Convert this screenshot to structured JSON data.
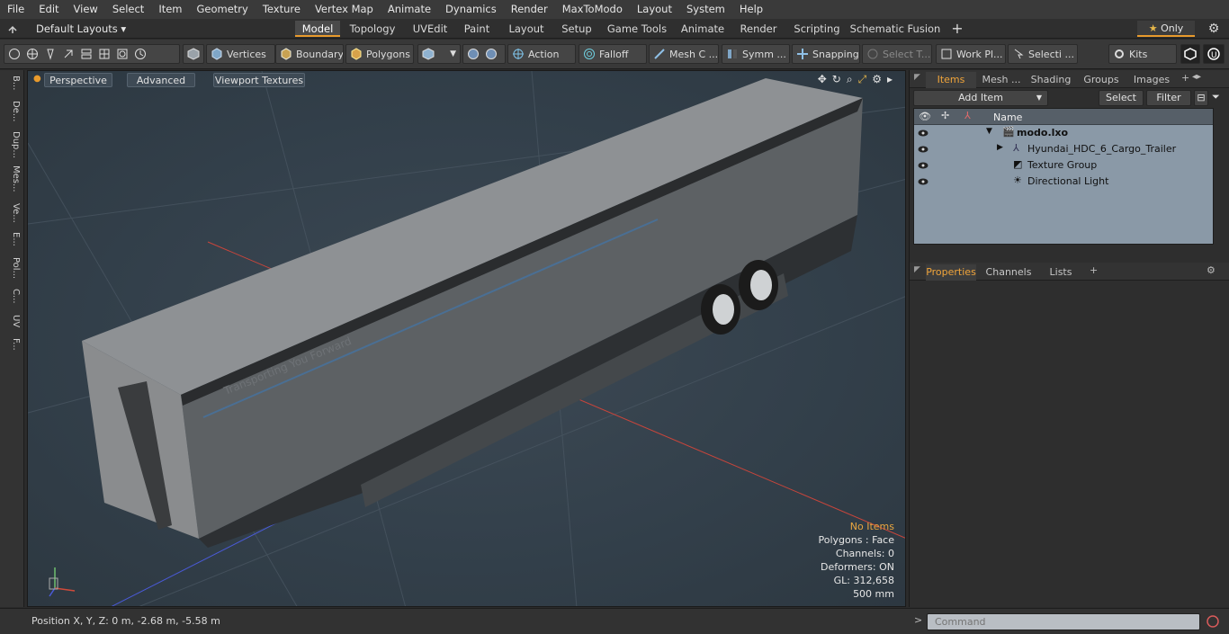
{
  "menu": [
    "File",
    "Edit",
    "View",
    "Select",
    "Item",
    "Geometry",
    "Texture",
    "Vertex Map",
    "Animate",
    "Dynamics",
    "Render",
    "MaxToModo",
    "Layout",
    "System",
    "Help"
  ],
  "layouts": {
    "label": "Default Layouts ▾"
  },
  "tabs": [
    "Model",
    "Topology",
    "UVEdit",
    "Paint",
    "Layout",
    "Setup",
    "Game Tools",
    "Animate",
    "Render",
    "Scripting",
    "Schematic Fusion"
  ],
  "active_tab": "Model",
  "only_label": "Only",
  "toolbar": {
    "vertices": "Vertices",
    "boundary": "Boundary",
    "polygons": "Polygons",
    "action": "Action",
    "falloff": "Falloff",
    "meshc": "Mesh C ...",
    "symm": "Symm ...",
    "snapping": "Snapping",
    "selectt": "Select T...",
    "workpl": "Work Pl...",
    "selecti": "Selecti ...",
    "kits": "Kits"
  },
  "left_tabs": [
    "B...",
    "De...",
    "Dup...",
    "Mes...",
    "Ve...",
    "E...",
    "Pol...",
    "C...",
    "UV",
    "F..."
  ],
  "viewport": {
    "perspective": "Perspective",
    "advanced": "Advanced",
    "textures": "Viewport Textures",
    "trailer_text": "Transporting You Forward",
    "stats": {
      "no_items": "No Items",
      "polygons": "Polygons : Face",
      "channels": "Channels: 0",
      "deformers": "Deformers: ON",
      "gl": "GL: 312,658",
      "size": "500 mm"
    }
  },
  "statusbar": {
    "position": "Position X, Y, Z:   0 m, -2.68 m, -5.58 m"
  },
  "panel": {
    "tabs": [
      "Items",
      "Mesh ...",
      "Shading",
      "Groups",
      "Images"
    ],
    "add_item": "Add Item",
    "select": "Select",
    "filter": "Filter",
    "col_name": "Name",
    "items": [
      {
        "name": "modo.lxo"
      },
      {
        "name": "Hyundai_HDC_6_Cargo_Trailer"
      },
      {
        "name": "Texture Group"
      },
      {
        "name": "Directional Light"
      }
    ],
    "lower_tabs": [
      "Properties",
      "Channels",
      "Lists"
    ]
  },
  "command": {
    "placeholder": "Command"
  },
  "colors": {
    "accent": "#e89a2c",
    "list_bg": "#8a99a7",
    "viewport_bg": "#36434e"
  }
}
